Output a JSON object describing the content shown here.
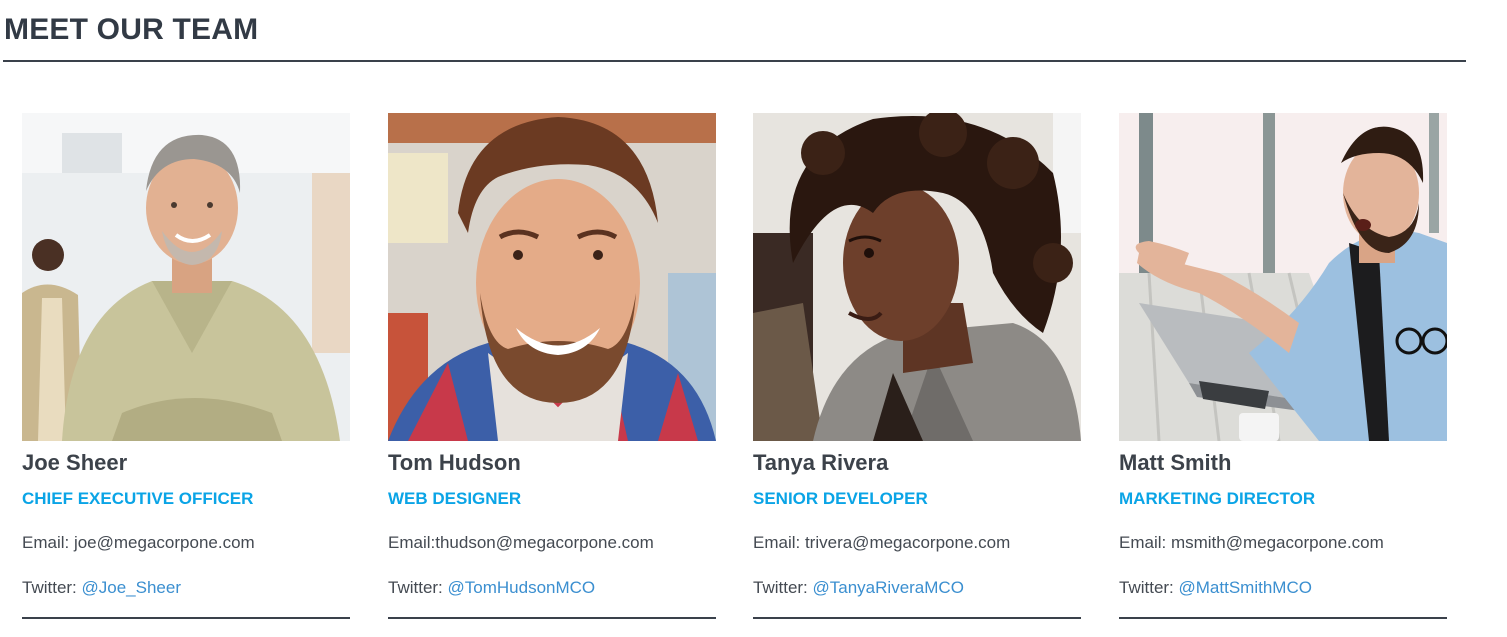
{
  "section": {
    "title": "MEET OUR TEAM"
  },
  "members": [
    {
      "name": "Joe Sheer",
      "role": "CHIEF EXECUTIVE OFFICER",
      "email_label": "Email: joe@megacorpone.com",
      "twitter_label": "Twitter: ",
      "twitter_handle": "@Joe_Sheer",
      "photo_alt": "Joe Sheer"
    },
    {
      "name": "Tom Hudson",
      "role": "WEB DESIGNER",
      "email_label": "Email:thudson@megacorpone.com",
      "twitter_label": "Twitter: ",
      "twitter_handle": "@TomHudsonMCO",
      "photo_alt": "Tom Hudson"
    },
    {
      "name": "Tanya Rivera",
      "role": "SENIOR DEVELOPER",
      "email_label": "Email: trivera@megacorpone.com",
      "twitter_label": "Twitter: ",
      "twitter_handle": "@TanyaRiveraMCO",
      "photo_alt": "Tanya Rivera"
    },
    {
      "name": "Matt Smith",
      "role": "MARKETING DIRECTOR",
      "email_label": "Email: msmith@megacorpone.com",
      "twitter_label": "Twitter: ",
      "twitter_handle": "@MattSmithMCO",
      "photo_alt": "Matt Smith"
    }
  ],
  "colors": {
    "heading": "#323a45",
    "role_accent": "#0aa4e6",
    "link": "#3b8fd0",
    "rule": "#3a414b"
  }
}
